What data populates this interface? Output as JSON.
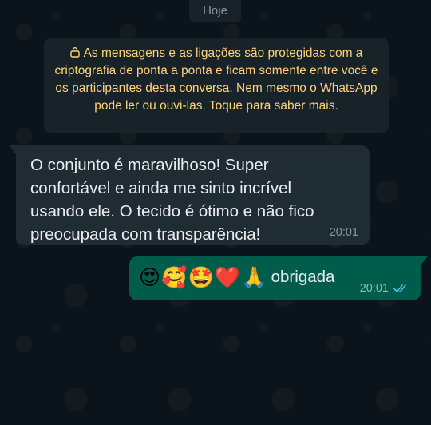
{
  "date_chip": {
    "label": "Hoje"
  },
  "encryption_notice": {
    "icon": "lock-icon",
    "text": "As mensagens e as ligações são protegidas com a criptografia de ponta a ponta e ficam somente entre você e os participantes desta conversa. Nem mesmo o WhatsApp pode ler ou ouvi-las. Toque para saber mais."
  },
  "messages": [
    {
      "direction": "incoming",
      "text": "O conjunto é maravilhoso! Super\nconfortável e ainda me sinto incrível\nusando ele. O tecido é ótimo e não fico\npreocupada com transparência!",
      "time": "20:01"
    },
    {
      "direction": "outgoing",
      "emojis": [
        "😍",
        "🥰",
        "🤩",
        "❤️",
        "🙏"
      ],
      "text": "obrigada",
      "time": "20:01",
      "status_icon": "double-check-read-icon"
    }
  ],
  "colors": {
    "background": "#0b141a",
    "incoming_bubble": "#202c33",
    "outgoing_bubble": "#005c4b",
    "notice_text": "#ffd279",
    "read_ticks": "#53bdeb"
  }
}
